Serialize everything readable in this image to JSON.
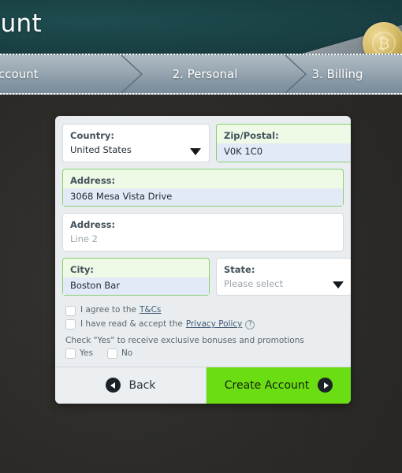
{
  "header": {
    "title": "count",
    "coin_glyph": "₿",
    "background_color": "#1a4346"
  },
  "steps": [
    {
      "label": "Account",
      "state": "active"
    },
    {
      "label": "2. Personal",
      "state": "inactive"
    },
    {
      "label": "3. Billing",
      "state": "inactive"
    }
  ],
  "form": {
    "fields": [
      {
        "name": "country",
        "label": "Country:",
        "value": "United States",
        "type": "select",
        "validated": false,
        "placeholder": false
      },
      {
        "name": "zip",
        "label": "Zip/Postal:",
        "value": "V0K 1C0",
        "type": "text",
        "validated": true,
        "placeholder": false
      },
      {
        "name": "address1",
        "label": "Address:",
        "value": "3068  Mesa Vista Drive",
        "type": "text",
        "validated": true,
        "placeholder": false
      },
      {
        "name": "address2",
        "label": "Address:",
        "value": "Line 2",
        "type": "text",
        "validated": false,
        "placeholder": true
      },
      {
        "name": "city",
        "label": "City:",
        "value": "Boston Bar",
        "type": "text",
        "validated": true,
        "placeholder": false
      },
      {
        "name": "state",
        "label": "State:",
        "value": "Please select",
        "type": "select",
        "validated": false,
        "placeholder": true
      }
    ],
    "consents": {
      "terms_prefix": "I agree to the",
      "terms_link": "T&Cs",
      "privacy_prefix": "I have read & accept the",
      "privacy_link": "Privacy Policy",
      "help_glyph": "?",
      "promo_text": "Check \"Yes\" to receive exclusive bonuses and promotions",
      "yes_label": "Yes",
      "no_label": "No"
    }
  },
  "footer": {
    "back_label": "Back",
    "create_label": "Create Account",
    "create_color": "#6ade12"
  }
}
